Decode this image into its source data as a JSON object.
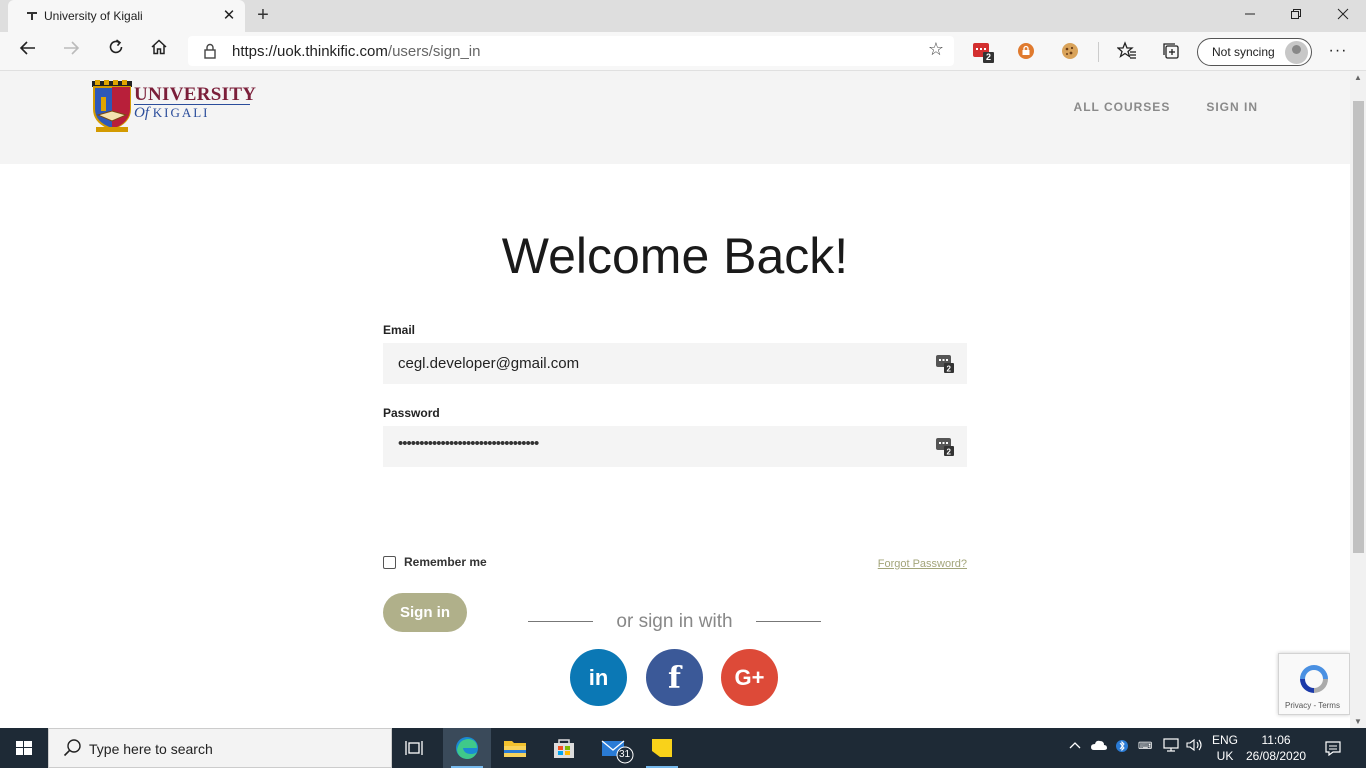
{
  "browser": {
    "tab_title": "University of Kigali",
    "tab_close": "✕",
    "new_tab": "+",
    "url_host": "https://uok.thinkific.com",
    "url_path": "/users/sign_in",
    "profile_label": "Not syncing",
    "ext_badge": "2"
  },
  "site": {
    "logo_line1": "UNIVERSITY",
    "logo_of": "Of ",
    "logo_kigali": "KIGALI",
    "nav": [
      "ALL COURSES",
      "SIGN IN"
    ]
  },
  "form": {
    "heading": "Welcome Back!",
    "email_label": "Email",
    "email_value": "cegl.developer@gmail.com",
    "password_label": "Password",
    "password_value": "•••••••••••••••••••••••••••••••••",
    "remember_label": "Remember me",
    "forgot_label": "Forgot Password?",
    "submit_label": "Sign in",
    "or_sign_in_with": "or sign in with"
  },
  "social": {
    "linkedin": "in",
    "facebook": "f",
    "google": "G+"
  },
  "recaptcha": {
    "footer": "Privacy - Terms"
  },
  "taskbar": {
    "search_placeholder": "Type here to search",
    "mail_badge": "31",
    "lang_line1": "ENG",
    "lang_line2": "UK",
    "time": "11:06",
    "date": "26/08/2020"
  },
  "colors": {
    "accent_button": "#b0b08a",
    "linkedin": "#0b78b5",
    "facebook": "#3b5998",
    "google": "#dd4a38",
    "taskbar": "#1e2a36"
  }
}
